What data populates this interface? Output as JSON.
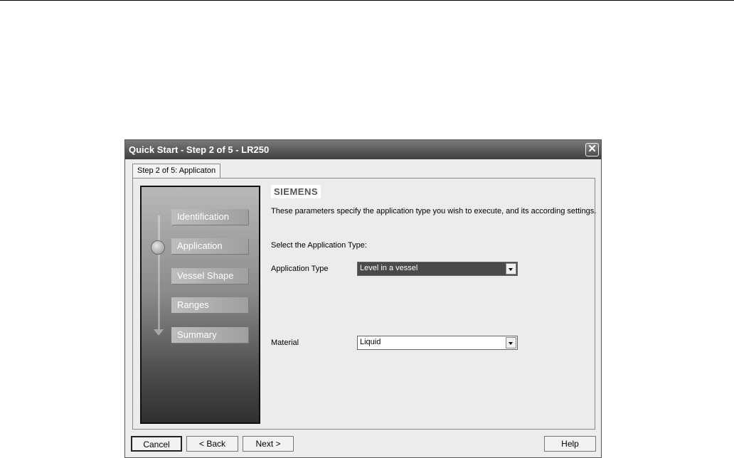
{
  "dialog": {
    "title": "Quick Start - Step 2 of 5 - LR250",
    "close_glyph": "✕"
  },
  "tab": {
    "label": "Step 2 of 5: Applicaton"
  },
  "steps": {
    "items": [
      {
        "label": "Identification"
      },
      {
        "label": "Application"
      },
      {
        "label": "Vessel Shape"
      },
      {
        "label": "Ranges"
      },
      {
        "label": "Summary"
      }
    ],
    "current_index": 1
  },
  "content": {
    "logo": "SIEMENS",
    "description": "These parameters specify the application type you wish to execute, and its according settings.",
    "prompt": "Select the Application Type:",
    "application_type": {
      "label": "Application Type",
      "value": "Level in a vessel"
    },
    "material": {
      "label": "Material",
      "value": "Liquid"
    }
  },
  "buttons": {
    "cancel": "Cancel",
    "back": "< Back",
    "next": "Next >",
    "help": "Help"
  },
  "icons": {
    "close": "close-icon",
    "dropdown": "chevron-down-icon",
    "step_indicator": "current-step-dot-icon"
  }
}
